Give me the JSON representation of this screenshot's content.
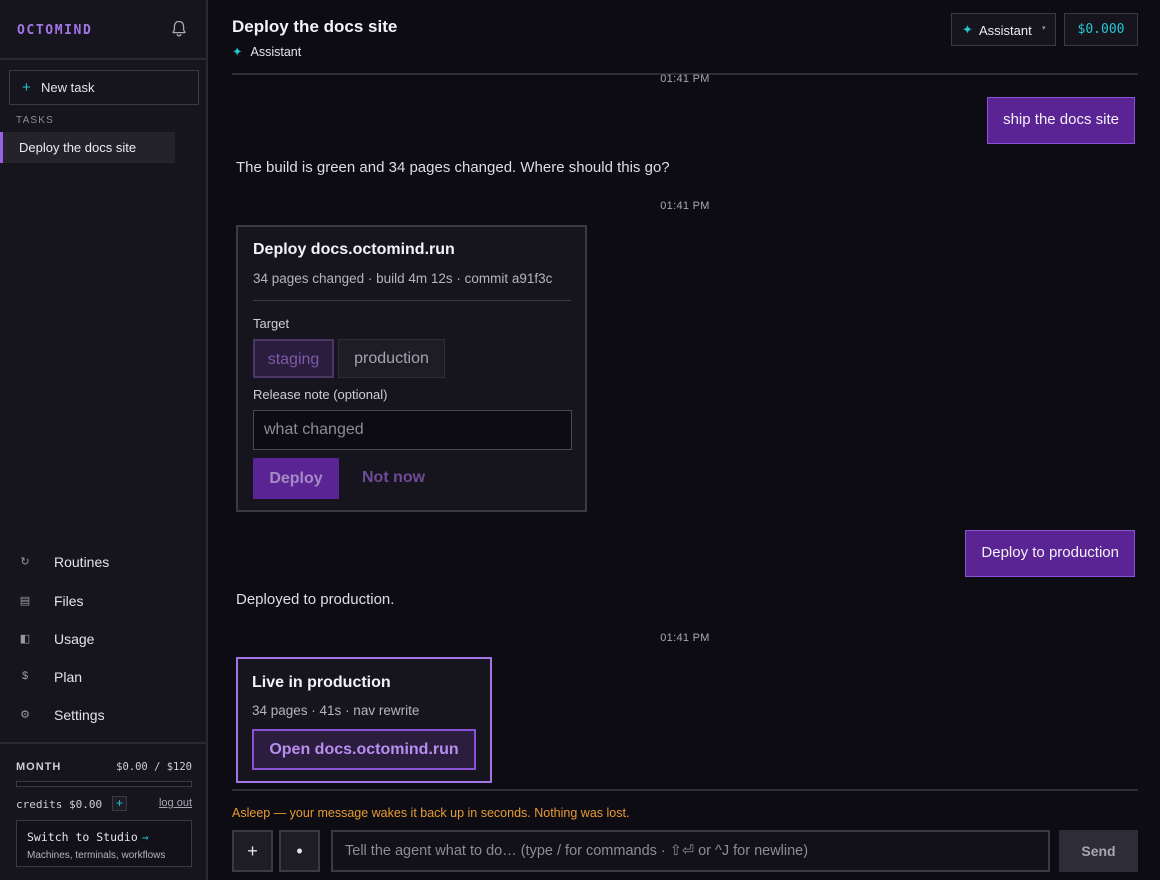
{
  "sidebar": {
    "brand": "OCTOMIND",
    "bell_icon": "bell-icon",
    "new_task": {
      "icon": "+",
      "label": "New task"
    },
    "tasks_heading": "TASKS",
    "tasks": [
      {
        "label": "Deploy the docs site",
        "active": true
      }
    ],
    "nav": [
      {
        "label": "Routines",
        "icon": "↻",
        "icon_name": "refresh-icon"
      },
      {
        "label": "Files",
        "icon": "▤",
        "icon_name": "files-icon"
      },
      {
        "label": "Usage",
        "icon": "◧",
        "icon_name": "usage-icon"
      },
      {
        "label": "Plan",
        "icon": "$",
        "icon_name": "dollar-icon"
      },
      {
        "label": "Settings",
        "icon": "⚙",
        "icon_name": "gear-icon"
      }
    ],
    "month": {
      "label": "MONTH",
      "value": "$0.00 / $120",
      "progress": 0,
      "credits": "credits $0.00",
      "credits_add": "+",
      "logout": "log out"
    },
    "studio": {
      "title": "Switch to Studio",
      "arrow": "→",
      "subtitle": "Machines, terminals, workflows"
    }
  },
  "header": {
    "title": "Deploy the docs site",
    "subtitle_icon": "✦",
    "subtitle": "Assistant",
    "model_button": {
      "icon": "✦",
      "label": "Assistant",
      "caret": "▾"
    },
    "cost": "$0.000"
  },
  "conversation": {
    "timestamp_1": "01:41 PM",
    "user_msg_1": "ship the docs site",
    "assistant_msg_1": "The build is green and 34 pages changed. Where should this go?",
    "timestamp_2": "01:41 PM",
    "deploy_card": {
      "title": "Deploy docs.octomind.run",
      "meta": "34 pages changed · build 4m 12s · commit a91f3c",
      "target_label": "Target",
      "options": [
        "staging",
        "production"
      ],
      "selected": "staging",
      "note_label": "Release note (optional)",
      "note_placeholder": "what changed",
      "deploy_label": "Deploy",
      "not_now_label": "Not now"
    },
    "user_msg_2": "Deploy to production",
    "assistant_msg_2": "Deployed to production.",
    "timestamp_3": "01:41 PM",
    "live_card": {
      "title": "Live in production",
      "meta": "34 pages · 41s · nav rewrite",
      "open_label": "Open docs.octomind.run"
    }
  },
  "footer": {
    "asleep_text": "Asleep — your message wakes it back up in seconds. Nothing was lost.",
    "plus_label": "+",
    "dot_label": "•",
    "input_placeholder": "Tell the agent what to do…  (type / for commands · ⇧⏎ or ^J for newline)",
    "send_label": "Send"
  },
  "colors": {
    "accent": "#9960e6",
    "user_bubble": "#5b2494",
    "cyan": "#23c6d4",
    "warning": "#e89a35",
    "background": "#0d0c13",
    "sidebar": "#16151d"
  }
}
